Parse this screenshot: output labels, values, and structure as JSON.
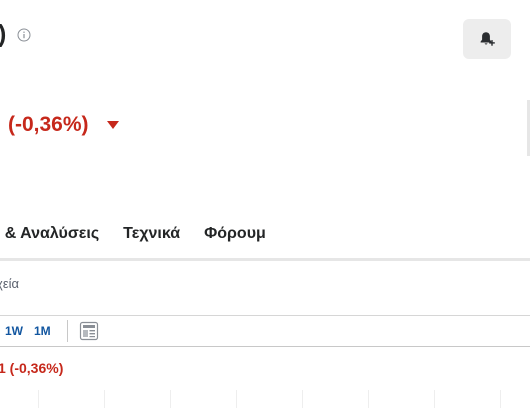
{
  "header": {
    "title_fragment": ")",
    "info_icon": "info-circle-icon",
    "alert_icon": "bell-plus-icon"
  },
  "quote": {
    "change": "(-0,36%)",
    "direction_icon": "triangle-down-icon",
    "color": "#c6281b"
  },
  "tabs": [
    {
      "label": "ς & Αναλύσεις"
    },
    {
      "label": "Τεχνικά"
    },
    {
      "label": "Φόρουμ"
    }
  ],
  "subtab": {
    "label": "χεία"
  },
  "chart_toolbar": {
    "ranges": [
      "1W",
      "1M"
    ],
    "chart_type_icon": "candlestick-chart-icon"
  },
  "chart": {
    "change_label": "1 (-0,36%)"
  },
  "colors": {
    "negative": "#c6281b",
    "link": "#1256a0",
    "text": "#232526"
  }
}
